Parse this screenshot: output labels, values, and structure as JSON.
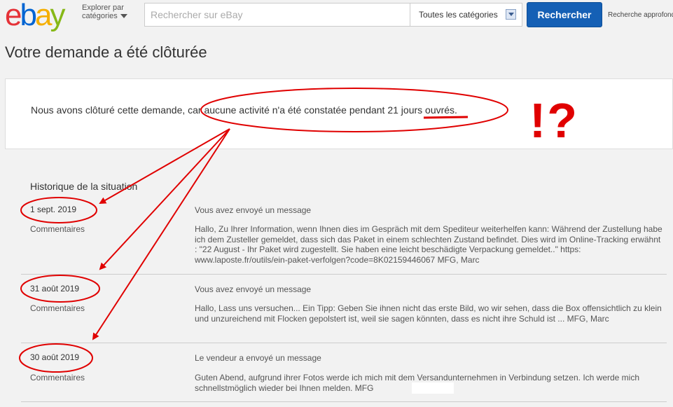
{
  "header": {
    "logo": {
      "e": "e",
      "b": "b",
      "a": "a",
      "y": "y"
    },
    "explore_line1": "Explorer par",
    "explore_line2": "catégories",
    "search_placeholder": "Rechercher sur eBay",
    "category": "Toutes les catégories",
    "search_button": "Rechercher",
    "advanced": "Recherche approfondie"
  },
  "page_title": "Votre demande a été clôturée",
  "notice": "Nous avons clôturé cette demande, car aucune activité n'a été constatée pendant 21 jours ouvrés.",
  "history_title": "Historique de la situation",
  "entries": [
    {
      "date": "1 sept. 2019",
      "comments": "Commentaires",
      "kind": "Vous avez envoyé un message",
      "body": "Hallo, Zu Ihrer Information, wenn Ihnen dies im Gespräch mit dem Spediteur weiterhelfen kann: Während der Zustellung habe ich dem Zusteller gemeldet, dass sich das Paket in einem schlechten Zustand befindet. Dies wird im Online-Tracking erwähnt : \"22 August - Ihr Paket wird zugestellt. Sie haben eine leicht beschädigte Verpackung gemeldet..\" https: www.laposte.fr/outils/ein-paket-verfolgen?code=8K02159446067 MFG, Marc"
    },
    {
      "date": "31 août 2019",
      "comments": "Commentaires",
      "kind": "Vous avez envoyé un message",
      "body": "Hallo, Lass uns versuchen... Ein Tipp: Geben Sie ihnen nicht das erste Bild, wo wir sehen, dass die Box offensichtlich zu klein und unzureichend mit Flocken gepolstert ist, weil sie sagen könnten, dass es nicht ihre Schuld ist ... MFG, Marc"
    },
    {
      "date": "30 août 2019",
      "comments": "Commentaires",
      "kind": "Le vendeur a envoyé un message",
      "body": "Guten Abend, aufgrund ihrer Fotos werde ich mich mit dem Versandunternehmen in Verbindung setzen. Ich werde mich schnellstmöglich wieder bei Ihnen melden. MFG"
    }
  ],
  "annotation": "!?",
  "colors": {
    "ebay_e": "#e53238",
    "ebay_b": "#0064d2",
    "ebay_a": "#f5af02",
    "ebay_y": "#86b817",
    "annotation": "#e00000"
  }
}
